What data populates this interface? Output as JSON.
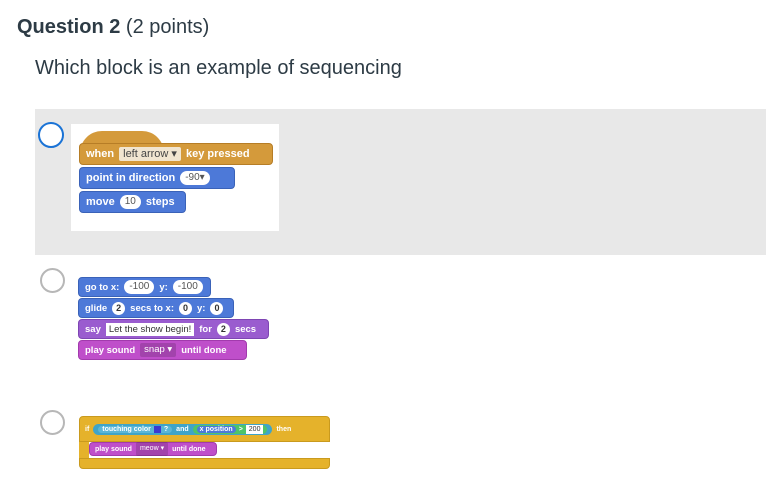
{
  "question": {
    "label": "Question 2",
    "points": "(2 points)",
    "prompt": "Which block is an example of sequencing"
  },
  "options": [
    {
      "selected": true,
      "blocks": {
        "b1": {
          "when": "when",
          "key": "left arrow",
          "key_pressed": "key pressed"
        },
        "b2": {
          "label": "point in direction",
          "value": "-90"
        },
        "b3": {
          "move": "move",
          "value": "10",
          "steps": "steps"
        }
      }
    },
    {
      "selected": false,
      "blocks": {
        "b1": {
          "goto": "go to x:",
          "x": "-100",
          "y_label": "y:",
          "y": "-100"
        },
        "b2": {
          "glide": "glide",
          "secs_val": "2",
          "secs_to": "secs to x:",
          "x": "0",
          "y_label": "y:",
          "y": "0"
        },
        "b3": {
          "say": "say",
          "text": "Let the show begin!",
          "for": "for",
          "secs_val": "2",
          "secs": "secs"
        },
        "b4": {
          "play": "play sound",
          "sound": "snap",
          "until": "until done"
        }
      }
    },
    {
      "selected": false,
      "blocks": {
        "b1": {
          "if": "if",
          "touching": "touching color",
          "q": "?",
          "and": "and",
          "xpos": "x position",
          "gt": ">",
          "value": "200",
          "then": "then"
        },
        "b2": {
          "play": "play sound",
          "sound": "meow",
          "until": "until done"
        }
      }
    }
  ],
  "colors": {
    "motion": "#4d79d8",
    "events": "#d49a3b",
    "looks": "#9a5ccf",
    "sound": "#bf4fca",
    "control": "#e5b22b",
    "selected_radio": "#1a73d6",
    "selected_band": "#e8e8e8"
  }
}
